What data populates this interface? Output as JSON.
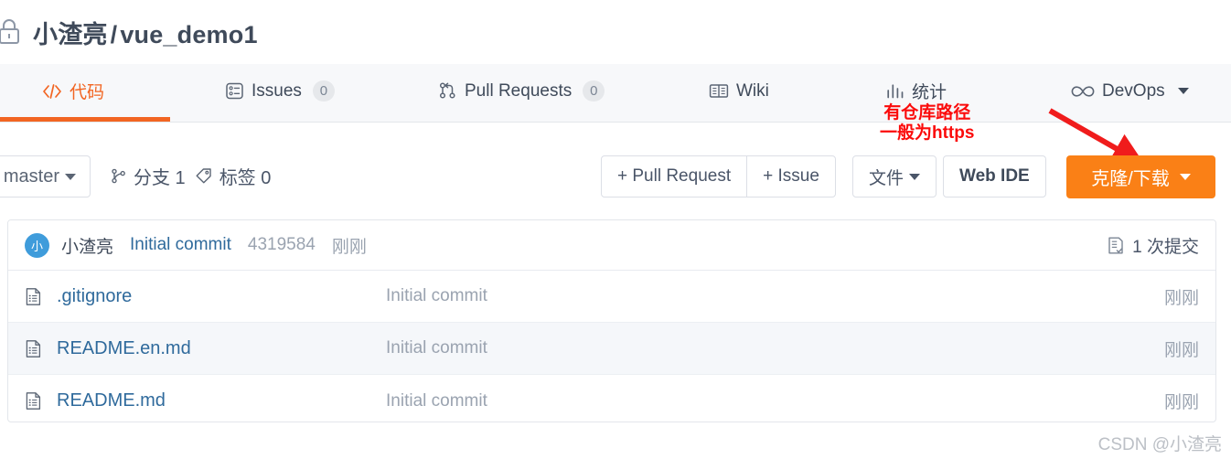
{
  "header": {
    "lock_icon": "lock-icon",
    "owner": "小渣亮",
    "separator": "/",
    "repo": "vue_demo1"
  },
  "nav": {
    "tabs": [
      {
        "label": "代码",
        "icon": "code-icon",
        "active": true,
        "badge": null
      },
      {
        "label": "Issues",
        "icon": "issues-icon",
        "active": false,
        "badge": "0"
      },
      {
        "label": "Pull Requests",
        "icon": "pull-request-icon",
        "active": false,
        "badge": "0"
      },
      {
        "label": "Wiki",
        "icon": "book-icon",
        "active": false,
        "badge": null
      },
      {
        "label": "统计",
        "icon": "bar-chart-icon",
        "active": false,
        "badge": null
      },
      {
        "label": "DevOps",
        "icon": "infinity-icon",
        "active": false,
        "badge": null,
        "has_caret": true
      }
    ]
  },
  "annotation": {
    "line1": "有仓库路径",
    "line2": "一般为https",
    "color": "#fb0b0b",
    "arrow": "red-arrow"
  },
  "toolbar": {
    "branch_selected": "master",
    "branches_label": "分支 1",
    "branches_icon": "branch-icon",
    "tags_label": "标签 0",
    "tags_icon": "tag-icon",
    "pull_request_button": "+ Pull Request",
    "issue_button": "+ Issue",
    "file_button": "文件",
    "web_ide_button": "Web IDE",
    "clone_button": "克隆/下载",
    "clone_color": "#fa8016"
  },
  "commit_bar": {
    "avatar_initial": "小",
    "avatar_color": "#3f9cdb",
    "author": "小渣亮",
    "message": "Initial commit",
    "hash": "4319584",
    "time": "刚刚",
    "count_icon": "commit-history-icon",
    "count_label": "1 次提交"
  },
  "files": {
    "rows": [
      {
        "name": ".gitignore",
        "icon": "file-icon",
        "commit": "Initial commit",
        "time": "刚刚",
        "highlighted": false
      },
      {
        "name": "README.en.md",
        "icon": "file-icon",
        "commit": "Initial commit",
        "time": "刚刚",
        "highlighted": true
      },
      {
        "name": "README.md",
        "icon": "file-icon",
        "commit": "Initial commit",
        "time": "刚刚",
        "highlighted": false
      }
    ]
  },
  "watermark": "CSDN @小渣亮"
}
